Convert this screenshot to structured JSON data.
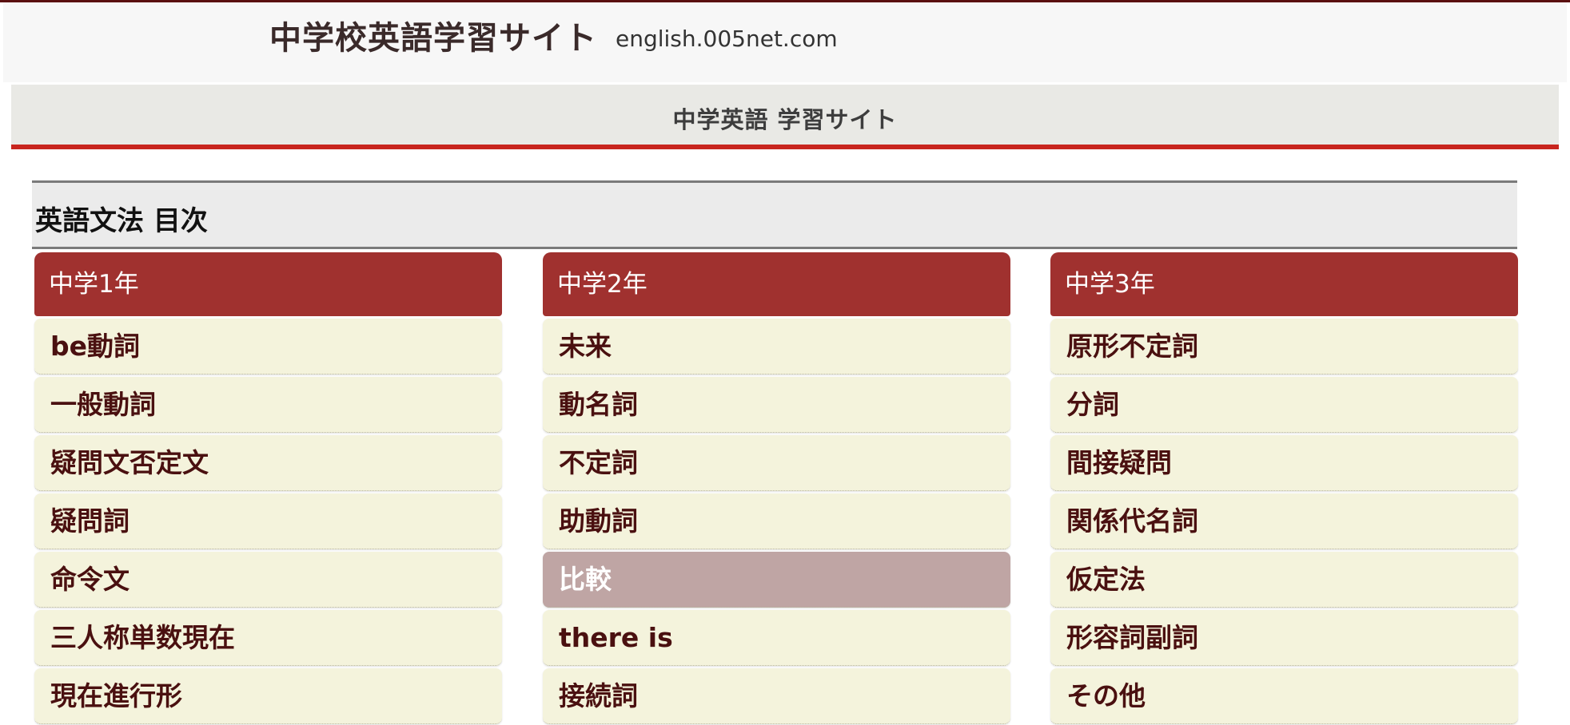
{
  "header": {
    "title": "中学校英語学習サイト",
    "domain": "english.005net.com"
  },
  "banner": {
    "text": "中学英語 学習サイト"
  },
  "toc": {
    "heading": "英語文法 目次"
  },
  "colors": {
    "grade_header": "#a0312f",
    "topic_bg": "#f4f3dc",
    "topic_text": "#4a1010",
    "topic_active_bg": "#bfa5a4",
    "banner_accent": "#c8251e"
  },
  "grades": [
    {
      "label": "中学1年",
      "topics": [
        "be動詞",
        "一般動詞",
        "疑問文否定文",
        "疑問詞",
        "命令文",
        "三人称単数現在",
        "現在進行形"
      ]
    },
    {
      "label": "中学2年",
      "topics": [
        "未来",
        "動名詞",
        "不定詞",
        "助動詞",
        "比較",
        "there is",
        "接続詞"
      ],
      "active_index": 4
    },
    {
      "label": "中学3年",
      "topics": [
        "原形不定詞",
        "分詞",
        "間接疑問",
        "関係代名詞",
        "仮定法",
        "形容詞副詞",
        "その他"
      ]
    }
  ]
}
